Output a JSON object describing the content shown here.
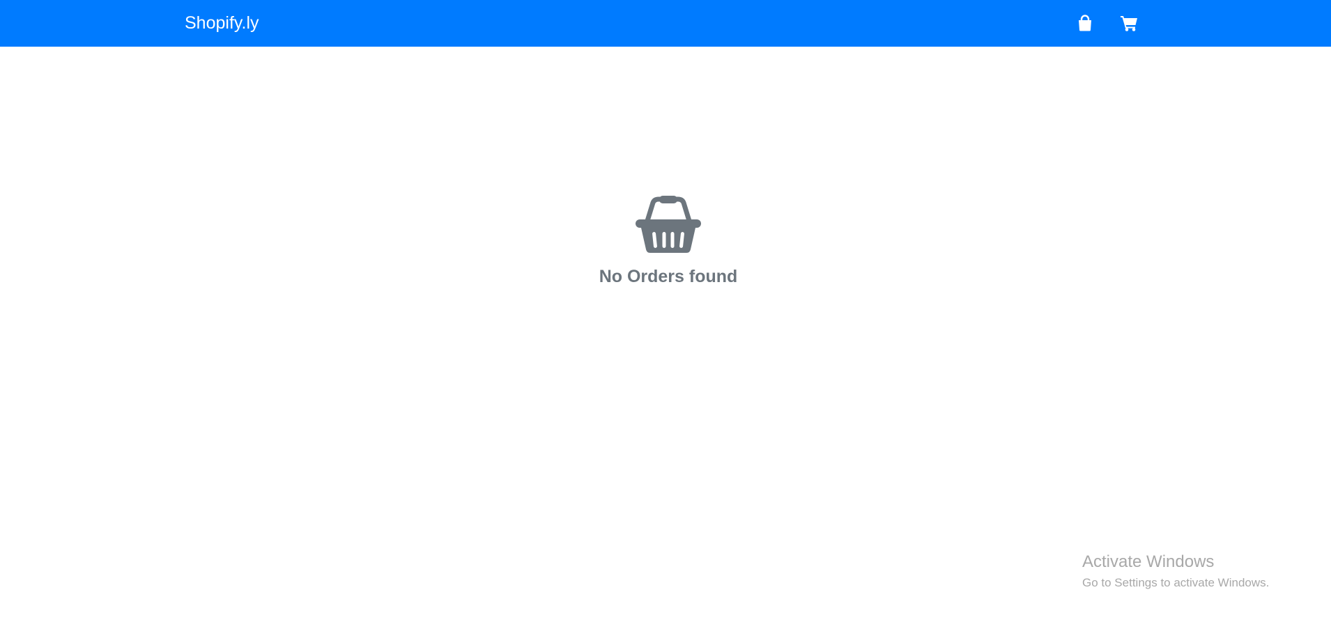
{
  "navbar": {
    "brand": "Shopify.ly",
    "icons": [
      "shopping-bag-icon",
      "shopping-cart-icon"
    ],
    "background": "#007bff"
  },
  "main": {
    "empty_icon": "shopping-basket-icon",
    "empty_message": "No Orders found",
    "text_color": "#6c757d"
  },
  "watermark": {
    "title": "Activate Windows",
    "subtitle": "Go to Settings to activate Windows."
  }
}
